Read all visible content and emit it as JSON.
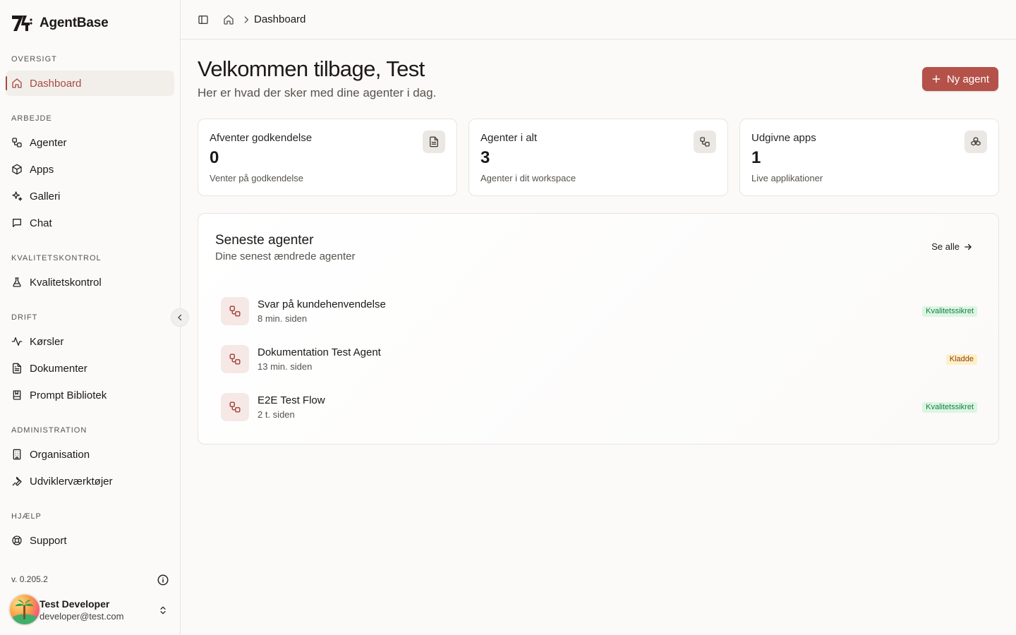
{
  "app": {
    "name": "AgentBase"
  },
  "sidebar": {
    "sections": {
      "overview": "OVERSIGT",
      "work": "ARBEJDE",
      "quality": "KVALITETSKONTROL",
      "operations": "DRIFT",
      "admin": "ADMINISTRATION",
      "help": "HJÆLP"
    },
    "items": {
      "dashboard": "Dashboard",
      "agents": "Agenter",
      "apps": "Apps",
      "gallery": "Galleri",
      "chat": "Chat",
      "quality": "Kvalitetskontrol",
      "runs": "Kørsler",
      "documents": "Dokumenter",
      "prompts": "Prompt Bibliotek",
      "organisation": "Organisation",
      "devtools": "Udviklerværktøjer",
      "support": "Support"
    },
    "active_item": "dashboard",
    "version": "v. 0.205.2",
    "user": {
      "name": "Test Developer",
      "email": "developer@test.com"
    }
  },
  "topbar": {
    "breadcrumb_current": "Dashboard"
  },
  "header": {
    "title": "Velkommen tilbage, Test",
    "subtitle": "Her er hvad der sker med dine agenter i dag.",
    "new_agent_label": "Ny agent"
  },
  "stats": [
    {
      "title": "Afventer godkendelse",
      "value": "0",
      "description": "Venter på godkendelse",
      "icon": "document-icon"
    },
    {
      "title": "Agenter i alt",
      "value": "3",
      "description": "Agenter i dit workspace",
      "icon": "workflow-icon"
    },
    {
      "title": "Udgivne apps",
      "value": "1",
      "description": "Live applikationer",
      "icon": "boxes-icon"
    }
  ],
  "recent": {
    "title": "Seneste agenter",
    "subtitle": "Dine senest ændrede agenter",
    "see_all_label": "Se alle",
    "agents": [
      {
        "name": "Svar på kundehenvendelse",
        "time": "8 min. siden",
        "status": "Kvalitetssikret",
        "status_color": "#15803d"
      },
      {
        "name": "Dokumentation Test Agent",
        "time": "13 min. siden",
        "status": "Kladde",
        "status_color": "#92400e"
      },
      {
        "name": "E2E Test Flow",
        "time": "2 t. siden",
        "status": "Kvalitetssikret",
        "status_color": "#15803d"
      }
    ]
  },
  "colors": {
    "accent": "#b4524a",
    "active_text": "#a64a42",
    "background": "#fbfaf8"
  }
}
